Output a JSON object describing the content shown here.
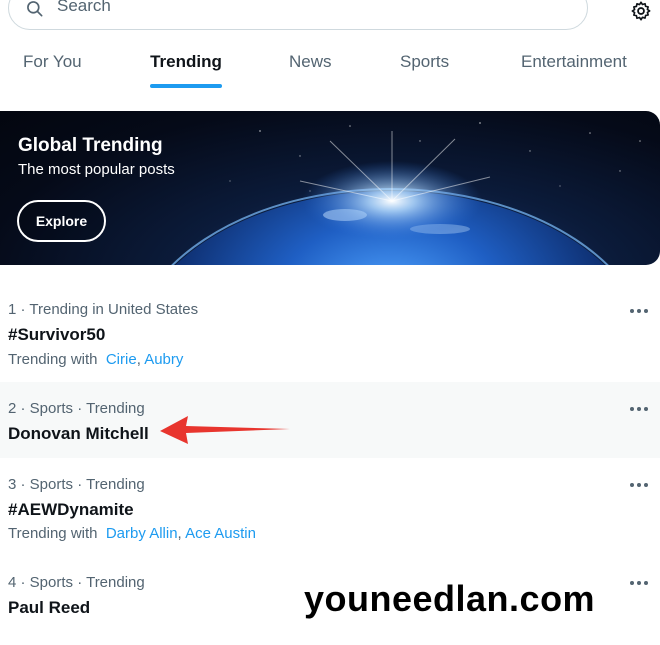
{
  "search": {
    "placeholder": "Search"
  },
  "tabs": [
    {
      "label": "For You",
      "active": false
    },
    {
      "label": "Trending",
      "active": true
    },
    {
      "label": "News",
      "active": false
    },
    {
      "label": "Sports",
      "active": false
    },
    {
      "label": "Entertainment",
      "active": false
    }
  ],
  "banner": {
    "title": "Global Trending",
    "subtitle": "The most popular posts",
    "button": "Explore"
  },
  "trends": [
    {
      "meta": "1 · Trending in United States",
      "name": "#Survivor50",
      "with_label": "Trending with",
      "with": [
        "Cirie",
        "Aubry"
      ]
    },
    {
      "meta": "2 · Sports · Trending",
      "name": "Donovan Mitchell",
      "with_label": "",
      "with": []
    },
    {
      "meta": "3 · Sports · Trending",
      "name": "#AEWDynamite",
      "with_label": "Trending with",
      "with": [
        "Darby Allin",
        "Ace Austin"
      ]
    },
    {
      "meta": "4 · Sports · Trending",
      "name": "Paul Reed",
      "with_label": "",
      "with": []
    }
  ],
  "watermark": "youneedlan.com",
  "colors": {
    "accent": "#1d9bf0",
    "arrow": "#e8352e",
    "text": "#0f1419",
    "muted": "#536471"
  },
  "icons": {
    "search": "search-icon",
    "settings": "gear-icon",
    "more": "more-horizontal-icon"
  }
}
